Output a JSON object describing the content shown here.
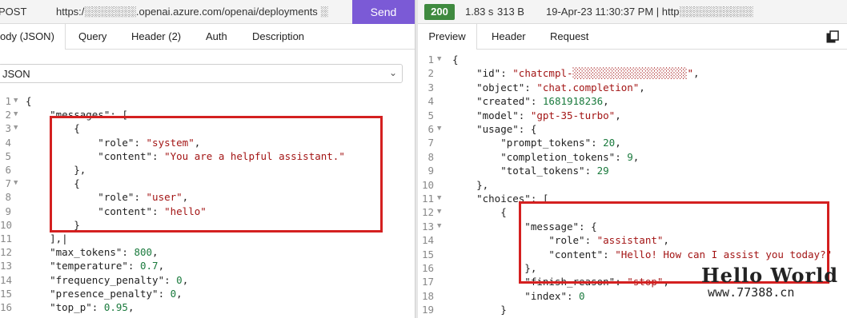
{
  "request": {
    "method": "POST",
    "url": "https:/░░░░░░░.openai.azure.com/openai/deployments ░",
    "send_label": "Send",
    "tabs": [
      "ody (JSON)",
      "Query",
      "Header (2)",
      "Auth",
      "Description"
    ],
    "format": "JSON",
    "body_lines": [
      {
        "n": "1",
        "fold": true,
        "parts": [
          {
            "t": "{",
            "c": "k"
          }
        ]
      },
      {
        "n": "2",
        "fold": true,
        "parts": [
          {
            "t": "    \"messages\": [",
            "c": "k"
          }
        ]
      },
      {
        "n": "3",
        "fold": true,
        "parts": [
          {
            "t": "        {",
            "c": "k"
          }
        ]
      },
      {
        "n": "4",
        "fold": false,
        "parts": [
          {
            "t": "            \"role\": ",
            "c": "k"
          },
          {
            "t": "\"system\"",
            "c": "s"
          },
          {
            "t": ",",
            "c": "k"
          }
        ]
      },
      {
        "n": "5",
        "fold": false,
        "parts": [
          {
            "t": "            \"content\": ",
            "c": "k"
          },
          {
            "t": "\"You are a helpful assistant.\"",
            "c": "s"
          }
        ]
      },
      {
        "n": "6",
        "fold": false,
        "parts": [
          {
            "t": "        },",
            "c": "k"
          }
        ]
      },
      {
        "n": "7",
        "fold": true,
        "parts": [
          {
            "t": "        {",
            "c": "k"
          }
        ]
      },
      {
        "n": "8",
        "fold": false,
        "parts": [
          {
            "t": "            \"role\": ",
            "c": "k"
          },
          {
            "t": "\"user\"",
            "c": "s"
          },
          {
            "t": ",",
            "c": "k"
          }
        ]
      },
      {
        "n": "9",
        "fold": false,
        "parts": [
          {
            "t": "            \"content\": ",
            "c": "k"
          },
          {
            "t": "\"hello\"",
            "c": "s"
          }
        ]
      },
      {
        "n": "10",
        "fold": false,
        "parts": [
          {
            "t": "        }",
            "c": "k"
          }
        ]
      },
      {
        "n": "11",
        "fold": false,
        "parts": [
          {
            "t": "    ],|",
            "c": "k"
          }
        ]
      },
      {
        "n": "12",
        "fold": false,
        "parts": [
          {
            "t": "    \"max_tokens\": ",
            "c": "k"
          },
          {
            "t": "800",
            "c": "n"
          },
          {
            "t": ",",
            "c": "k"
          }
        ]
      },
      {
        "n": "13",
        "fold": false,
        "parts": [
          {
            "t": "    \"temperature\": ",
            "c": "k"
          },
          {
            "t": "0.7",
            "c": "n"
          },
          {
            "t": ",",
            "c": "k"
          }
        ]
      },
      {
        "n": "14",
        "fold": false,
        "parts": [
          {
            "t": "    \"frequency_penalty\": ",
            "c": "k"
          },
          {
            "t": "0",
            "c": "n"
          },
          {
            "t": ",",
            "c": "k"
          }
        ]
      },
      {
        "n": "15",
        "fold": false,
        "parts": [
          {
            "t": "    \"presence_penalty\": ",
            "c": "k"
          },
          {
            "t": "0",
            "c": "n"
          },
          {
            "t": ",",
            "c": "k"
          }
        ]
      },
      {
        "n": "16",
        "fold": false,
        "parts": [
          {
            "t": "    \"top_p\": ",
            "c": "k"
          },
          {
            "t": "0.95",
            "c": "n"
          },
          {
            "t": ",",
            "c": "k"
          }
        ]
      }
    ]
  },
  "response": {
    "status": "200",
    "time": "1.83 s",
    "size": "313 B",
    "meta": "19-Apr-23 11:30:37 PM | http░░░░░░░░░░",
    "tabs": [
      "Preview",
      "Header",
      "Request"
    ],
    "copy_icon": "copy-icon",
    "body_lines": [
      {
        "n": "1",
        "fold": true,
        "parts": [
          {
            "t": "{",
            "c": "k"
          }
        ]
      },
      {
        "n": "2",
        "fold": false,
        "parts": [
          {
            "t": "    \"id\": ",
            "c": "k"
          },
          {
            "t": "\"chatcmpl-░░░░░░░░░░░░░░░░░░░\"",
            "c": "s"
          },
          {
            "t": ",",
            "c": "k"
          }
        ]
      },
      {
        "n": "3",
        "fold": false,
        "parts": [
          {
            "t": "    \"object\": ",
            "c": "k"
          },
          {
            "t": "\"chat.completion\"",
            "c": "s"
          },
          {
            "t": ",",
            "c": "k"
          }
        ]
      },
      {
        "n": "4",
        "fold": false,
        "parts": [
          {
            "t": "    \"created\": ",
            "c": "k"
          },
          {
            "t": "1681918236",
            "c": "n"
          },
          {
            "t": ",",
            "c": "k"
          }
        ]
      },
      {
        "n": "5",
        "fold": false,
        "parts": [
          {
            "t": "    \"model\": ",
            "c": "k"
          },
          {
            "t": "\"gpt-35-turbo\"",
            "c": "s"
          },
          {
            "t": ",",
            "c": "k"
          }
        ]
      },
      {
        "n": "6",
        "fold": true,
        "parts": [
          {
            "t": "    \"usage\": {",
            "c": "k"
          }
        ]
      },
      {
        "n": "7",
        "fold": false,
        "parts": [
          {
            "t": "        \"prompt_tokens\": ",
            "c": "k"
          },
          {
            "t": "20",
            "c": "n"
          },
          {
            "t": ",",
            "c": "k"
          }
        ]
      },
      {
        "n": "8",
        "fold": false,
        "parts": [
          {
            "t": "        \"completion_tokens\": ",
            "c": "k"
          },
          {
            "t": "9",
            "c": "n"
          },
          {
            "t": ",",
            "c": "k"
          }
        ]
      },
      {
        "n": "9",
        "fold": false,
        "parts": [
          {
            "t": "        \"total_tokens\": ",
            "c": "k"
          },
          {
            "t": "29",
            "c": "n"
          }
        ]
      },
      {
        "n": "10",
        "fold": false,
        "parts": [
          {
            "t": "    },",
            "c": "k"
          }
        ]
      },
      {
        "n": "11",
        "fold": true,
        "parts": [
          {
            "t": "    \"choices\": [",
            "c": "k"
          }
        ]
      },
      {
        "n": "12",
        "fold": true,
        "parts": [
          {
            "t": "        {",
            "c": "k"
          }
        ]
      },
      {
        "n": "13",
        "fold": true,
        "parts": [
          {
            "t": "            \"message\": {",
            "c": "k"
          }
        ]
      },
      {
        "n": "14",
        "fold": false,
        "parts": [
          {
            "t": "                \"role\": ",
            "c": "k"
          },
          {
            "t": "\"assistant\"",
            "c": "s"
          },
          {
            "t": ",",
            "c": "k"
          }
        ]
      },
      {
        "n": "15",
        "fold": false,
        "parts": [
          {
            "t": "                \"content\": ",
            "c": "k"
          },
          {
            "t": "\"Hello! How can I assist you today?\"",
            "c": "s"
          }
        ]
      },
      {
        "n": "16",
        "fold": false,
        "parts": [
          {
            "t": "            },",
            "c": "k"
          }
        ]
      },
      {
        "n": "17",
        "fold": false,
        "parts": [
          {
            "t": "            \"finish_reason\": ",
            "c": "k"
          },
          {
            "t": "\"stop\"",
            "c": "s"
          },
          {
            "t": ",",
            "c": "k"
          }
        ]
      },
      {
        "n": "18",
        "fold": false,
        "parts": [
          {
            "t": "            \"index\": ",
            "c": "k"
          },
          {
            "t": "0",
            "c": "n"
          }
        ]
      },
      {
        "n": "19",
        "fold": false,
        "parts": [
          {
            "t": "        }",
            "c": "k"
          }
        ]
      }
    ]
  },
  "watermark": {
    "title": "Hello World",
    "url": "www.77388.cn"
  },
  "colors": {
    "send_button": "#7b5ad6",
    "status_ok": "#3f8a3f",
    "highlight_box": "#d42020",
    "string": "#a31515",
    "number": "#1a7a3d"
  }
}
